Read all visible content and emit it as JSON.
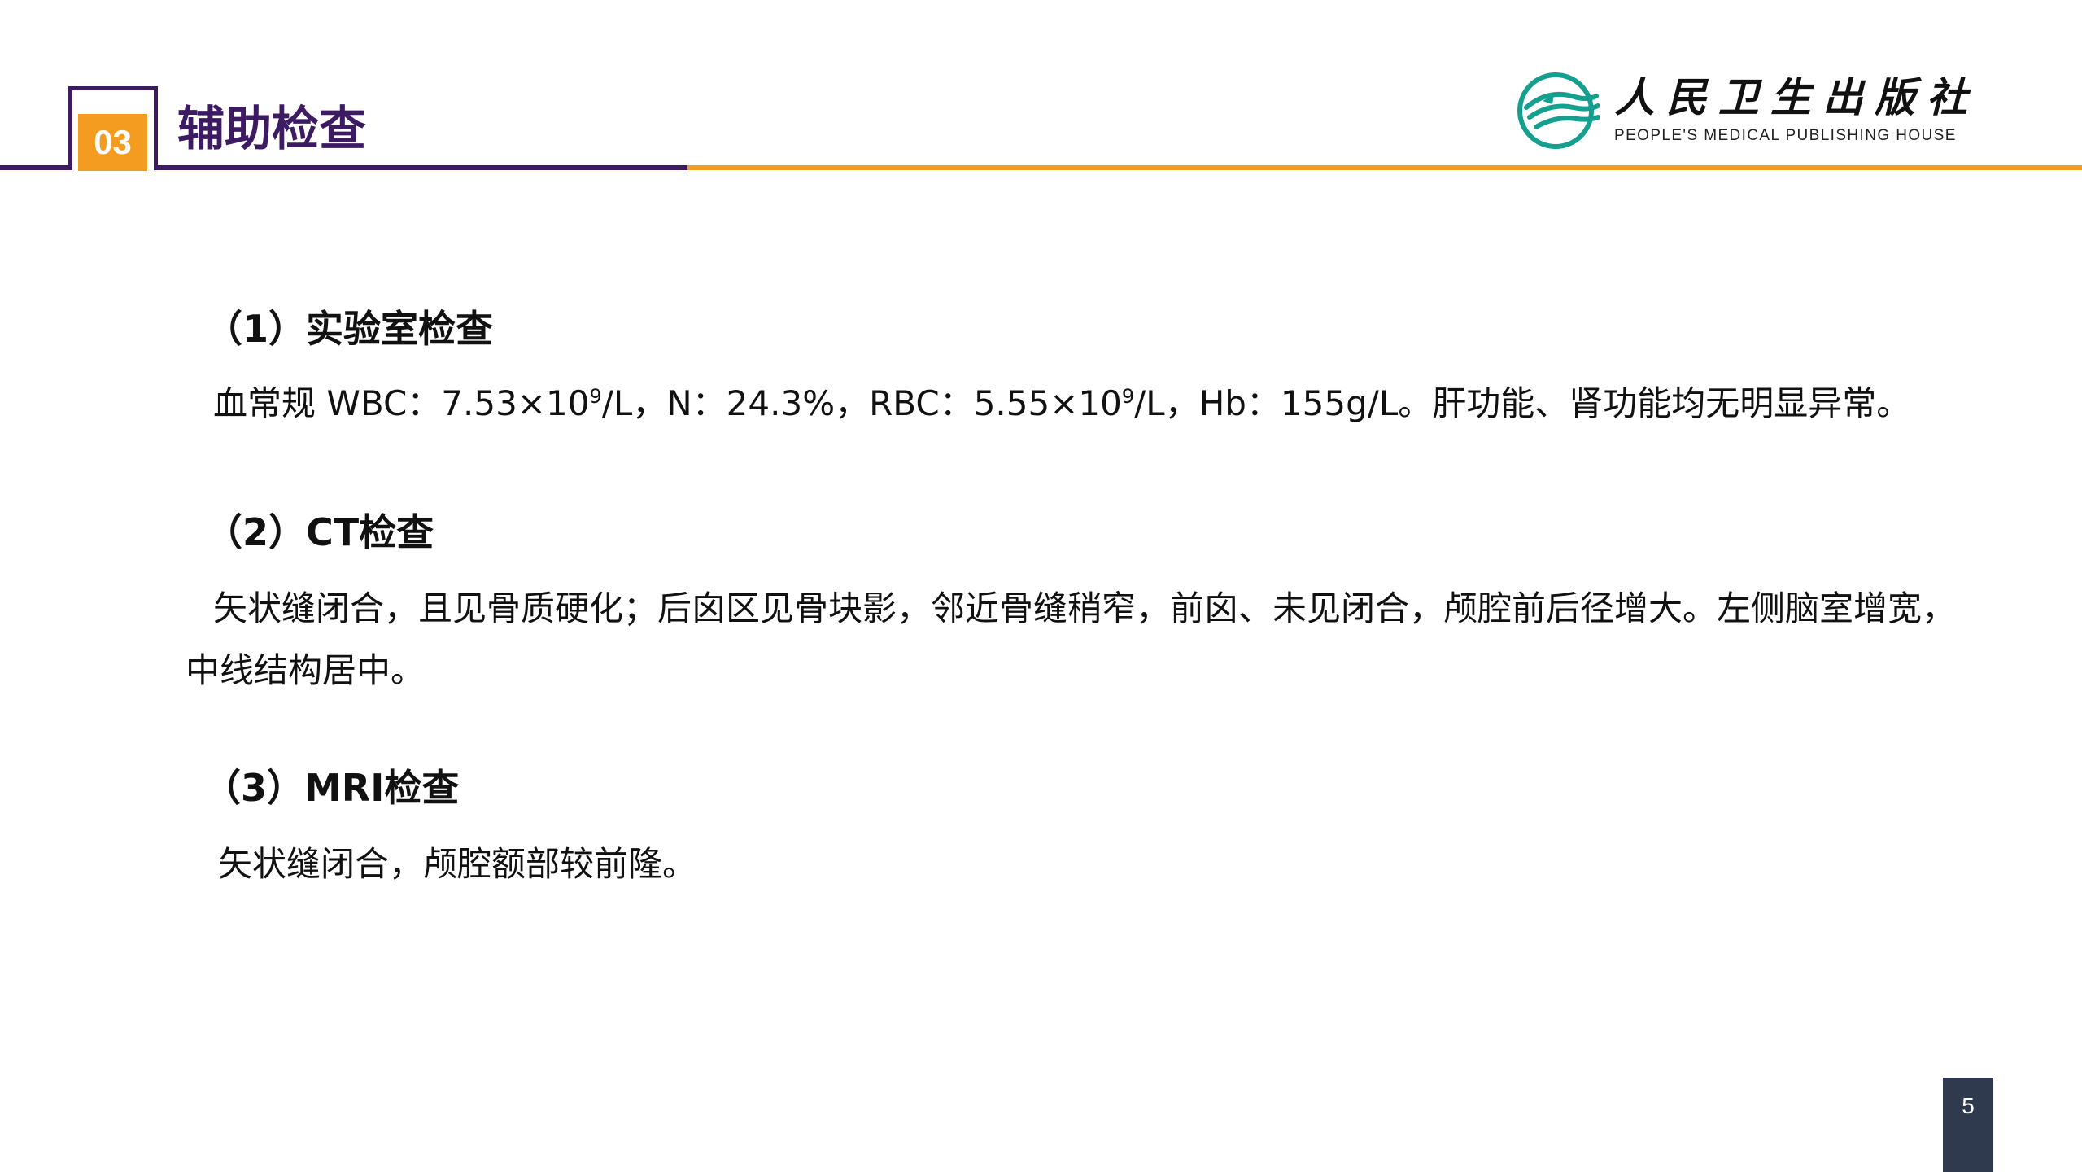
{
  "header": {
    "section_number": "03",
    "section_title": "辅助检查",
    "colors": {
      "purple": "#3d1b63",
      "orange": "#f39c1f",
      "teal": "#159f8e"
    }
  },
  "logo": {
    "name_cn": "人民卫生出版社",
    "name_en": "PEOPLE'S MEDICAL PUBLISHING HOUSE",
    "icon": "publisher-emblem-icon"
  },
  "sections": [
    {
      "heading": "（1）实验室检查",
      "body": {
        "prefix": "血常规 WBC：7.53×10",
        "exp1": "9",
        "middle": "/L，N：24.3%，RBC：5.55×10",
        "exp2": "9",
        "suffix": "/L，Hb：155g/L。肝功能、肾功能均无明显异常。"
      }
    },
    {
      "heading": "（2）CT检查",
      "body": "矢状缝闭合，且见骨质硬化；后囟区见骨块影，邻近骨缝稍窄，前囟、未见闭合，颅腔前后径增大。左侧脑室增宽，中线结构居中。"
    },
    {
      "heading": "（3）MRI检查",
      "body": "矢状缝闭合，颅腔额部较前隆。"
    }
  ],
  "footer": {
    "page_number": "5"
  }
}
